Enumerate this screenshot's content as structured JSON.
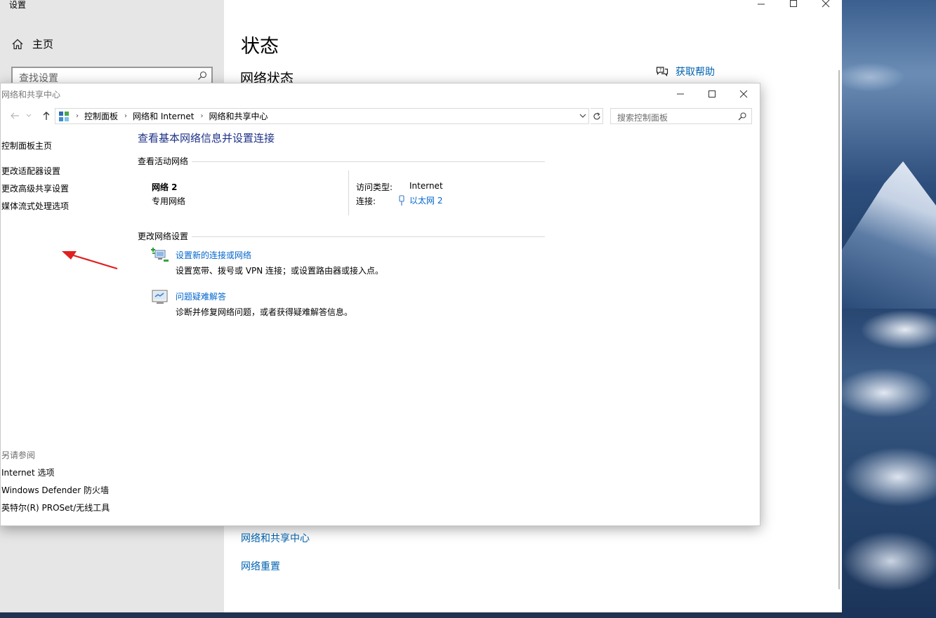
{
  "settings": {
    "window_title": "设置",
    "home_label": "主页",
    "search_placeholder": "查找设置",
    "page_title": "状态",
    "section_title": "网络状态",
    "help_label": "获取帮助",
    "links": [
      "网络和共享中心",
      "网络重置"
    ]
  },
  "nsc": {
    "window_title": "网络和共享中心",
    "breadcrumb": [
      "控制面板",
      "网络和 Internet",
      "网络和共享中心"
    ],
    "search_placeholder": "搜索控制面板",
    "left_nav": {
      "home": "控制面板主页",
      "items": [
        "更改适配器设置",
        "更改高级共享设置",
        "媒体流式处理选项"
      ],
      "see_also_label": "另请参阅",
      "see_also": [
        "Internet 选项",
        "Windows Defender 防火墙",
        "英特尔(R) PROSet/无线工具"
      ]
    },
    "heading": "查看基本网络信息并设置连接",
    "active_networks_label": "查看活动网络",
    "network": {
      "name": "网络 2",
      "category": "专用网络",
      "access_type_label": "访问类型:",
      "access_type_value": "Internet",
      "connection_label": "连接:",
      "connection_value": "以太网 2"
    },
    "change_settings_label": "更改网络设置",
    "tasks": [
      {
        "title": "设置新的连接或网络",
        "desc": "设置宽带、拨号或 VPN 连接；或设置路由器或接入点。",
        "icon": "new-connection-icon"
      },
      {
        "title": "问题疑难解答",
        "desc": "诊断并修复网络问题，或者获得疑难解答信息。",
        "icon": "troubleshoot-icon"
      }
    ]
  },
  "colors": {
    "link": "#0066cc",
    "heading": "#1e3287",
    "annotation_arrow": "#e02020"
  }
}
